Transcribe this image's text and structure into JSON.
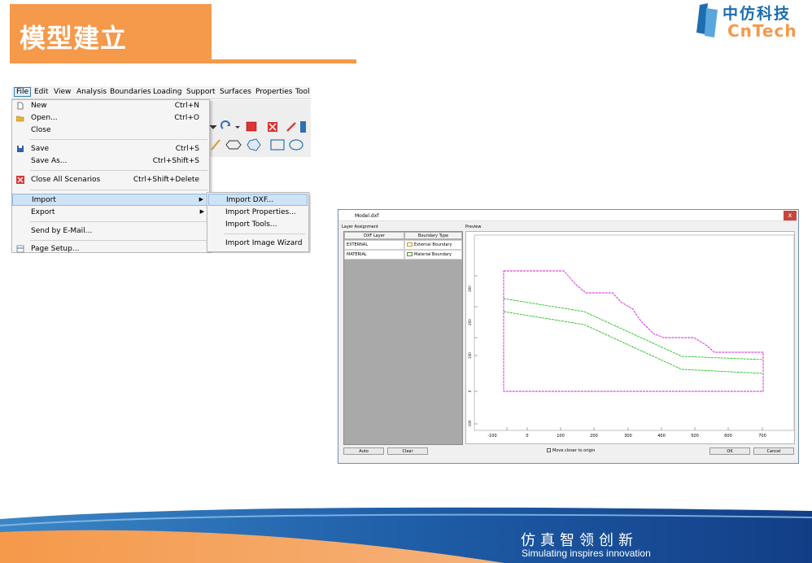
{
  "slide": {
    "title": "模型建立",
    "logo_cn": "中仿科技",
    "logo_en": "CnTech",
    "slogan_cn": "仿真智领创新",
    "slogan_en": "Simulating inspires innovation",
    "colors": {
      "accent_orange": "#f5994a",
      "brand_blue": "#1d6db0"
    }
  },
  "menubar": {
    "items": [
      "File",
      "Edit",
      "View",
      "Analysis",
      "Boundaries",
      "Loading",
      "Support",
      "Surfaces",
      "Properties",
      "Tool"
    ]
  },
  "file_menu": {
    "items": [
      {
        "label": "New",
        "shortcut": "Ctrl+N",
        "icon": "new-file-icon"
      },
      {
        "label": "Open...",
        "shortcut": "Ctrl+O",
        "icon": "open-folder-icon"
      },
      {
        "label": "Close",
        "shortcut": "",
        "icon": ""
      },
      {
        "label": "Save",
        "shortcut": "Ctrl+S",
        "icon": "save-disk-icon"
      },
      {
        "label": "Save As...",
        "shortcut": "Ctrl+Shift+S",
        "icon": ""
      },
      {
        "label": "Close All Scenarios",
        "shortcut": "Ctrl+Shift+Delete",
        "icon": "close-all-icon"
      },
      {
        "label": "Import",
        "shortcut": "",
        "icon": ""
      },
      {
        "label": "Export",
        "shortcut": "",
        "icon": ""
      },
      {
        "label": "Send by E-Mail...",
        "shortcut": "",
        "icon": ""
      },
      {
        "label": "Page Setup...",
        "shortcut": "",
        "icon": "page-setup-icon"
      }
    ]
  },
  "import_submenu": {
    "items": [
      "Import DXF...",
      "Import Properties...",
      "Import Tools...",
      "Import Image Wizard"
    ]
  },
  "dialog": {
    "title": "Model.dxf",
    "close_label": "x",
    "layer_assignment_label": "Layer Assignment",
    "preview_label": "Preview",
    "columns": [
      "DXF Layer",
      "Boundary Type"
    ],
    "rows": [
      {
        "layer": "EXTERNAL",
        "type": "External Boundary"
      },
      {
        "layer": "MATERIAL",
        "type": "Material Boundary"
      }
    ],
    "buttons": {
      "auto": "Auto",
      "clear": "Clear",
      "ok": "OK",
      "cancel": "Cancel"
    },
    "checkbox_label": "Move closer to origin",
    "x_ticks": [
      "-100",
      "0",
      "100",
      "200",
      "300",
      "400",
      "500",
      "600",
      "700"
    ],
    "y_ticks": [
      "-100",
      "0",
      "100",
      "200",
      "300"
    ]
  }
}
